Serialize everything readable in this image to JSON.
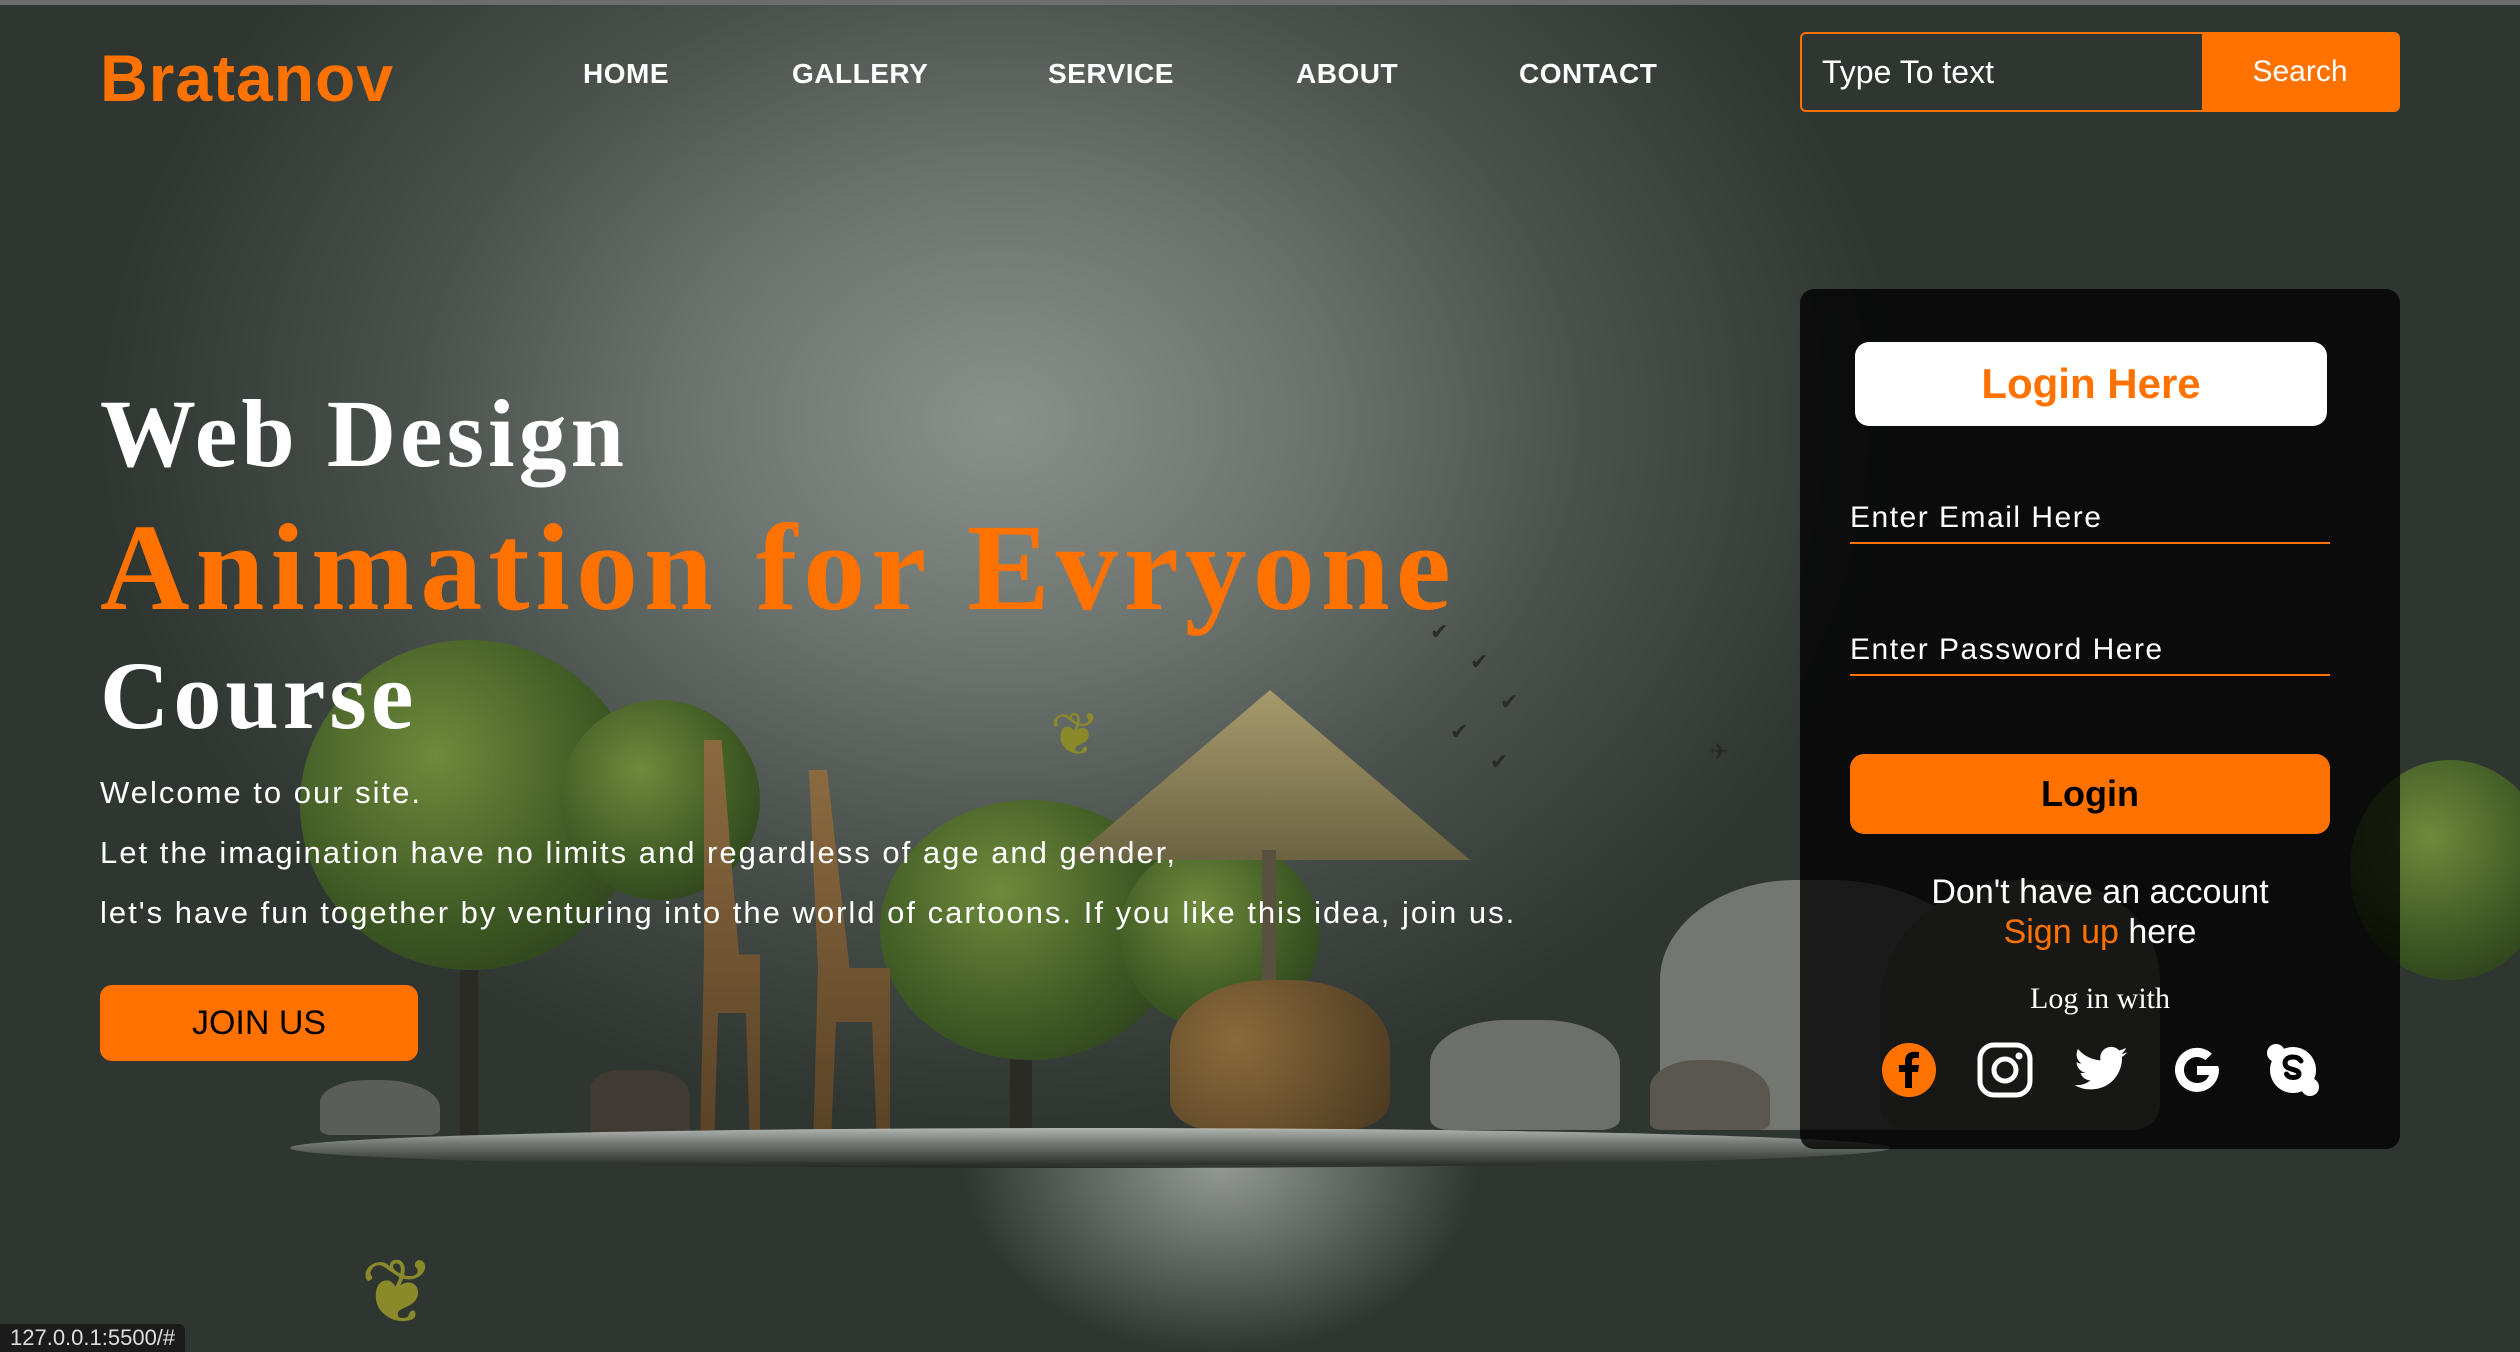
{
  "header": {
    "logo": "Bratanov",
    "nav": [
      "HOME",
      "GALLERY",
      "SERVICE",
      "ABOUT",
      "CONTACT"
    ],
    "search": {
      "placeholder": "Type To text",
      "button_label": "Search"
    }
  },
  "hero": {
    "line1": "Web Design",
    "line2": "Animation for Evryone",
    "line3": "Course",
    "paragraph": [
      "Welcome to our site.",
      "Let the imagination have no limits and regardless of age and gender,",
      "let's have fun together by venturing into the world of cartoons. If you like this idea, join us."
    ],
    "join_label": "JOIN US"
  },
  "login": {
    "title": "Login Here",
    "email_placeholder": "Enter Email Here",
    "password_placeholder": "Enter Password Here",
    "button_label": "Login",
    "no_account": "Don't have an account",
    "signup_link": "Sign up",
    "signup_suffix": " here",
    "log_in_with": "Log in with",
    "socials": [
      "facebook-icon",
      "instagram-icon",
      "twitter-icon",
      "google-icon",
      "skype-icon"
    ]
  },
  "status_bar": {
    "url": "127.0.0.1:5500/#"
  },
  "colors": {
    "accent": "#ff7200",
    "card_bg": "#000000",
    "text": "#ffffff"
  }
}
